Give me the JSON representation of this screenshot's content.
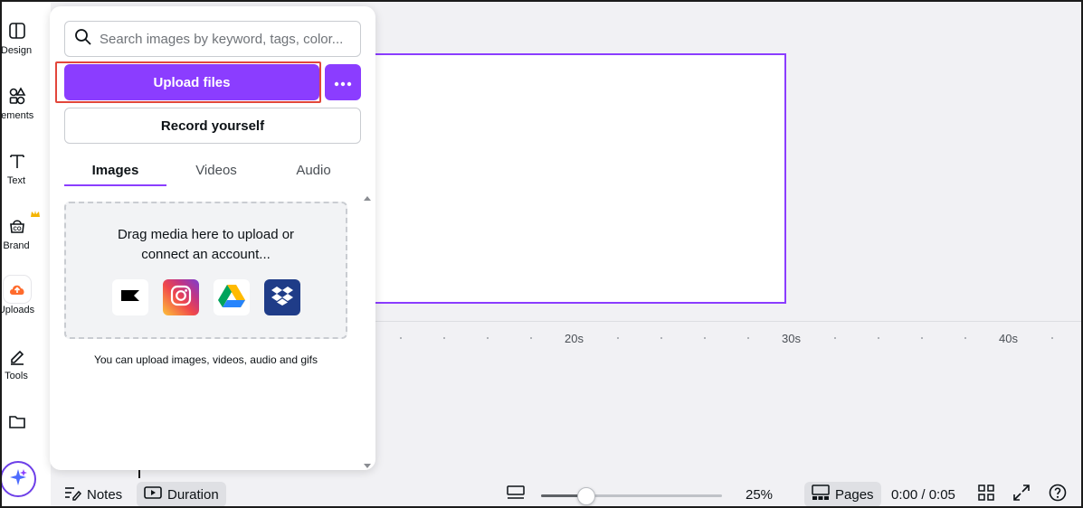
{
  "sidebar": {
    "items": [
      {
        "label": "Design",
        "icon": "layout-icon"
      },
      {
        "label": "lements",
        "icon": "shapes-icon"
      },
      {
        "label": "Text",
        "icon": "text-icon"
      },
      {
        "label": "Brand",
        "icon": "brand-icon"
      },
      {
        "label": "Uploads",
        "icon": "cloud-upload-icon",
        "active": true
      },
      {
        "label": "Tools",
        "icon": "pen-icon"
      },
      {
        "label": "",
        "icon": "folder-icon"
      }
    ],
    "magic_icon": "sparkle-icon"
  },
  "panel": {
    "search": {
      "placeholder": "Search images by keyword, tags, color..."
    },
    "upload_label": "Upload files",
    "more_icon": "more-dots-icon",
    "record_label": "Record yourself",
    "tabs": [
      {
        "label": "Images",
        "active": true
      },
      {
        "label": "Videos",
        "active": false
      },
      {
        "label": "Audio",
        "active": false
      }
    ],
    "dropzone": {
      "line1": "Drag media here to upload or",
      "line2": "connect an account...",
      "apps": [
        "capcut-icon",
        "instagram-icon",
        "google-drive-icon",
        "dropbox-icon"
      ]
    },
    "hint": "You can upload images, videos, audio and gifs"
  },
  "timeline": {
    "labels": [
      "20s",
      "30s",
      "40s"
    ]
  },
  "bottom_bar": {
    "notes_label": "Notes",
    "duration_label": "Duration",
    "zoom": "25%",
    "zoom_fraction": 0.25,
    "pages_label": "Pages",
    "time": "0:00 / 0:05"
  },
  "colors": {
    "accent": "#8b3dff",
    "highlight": "#e2463b"
  }
}
